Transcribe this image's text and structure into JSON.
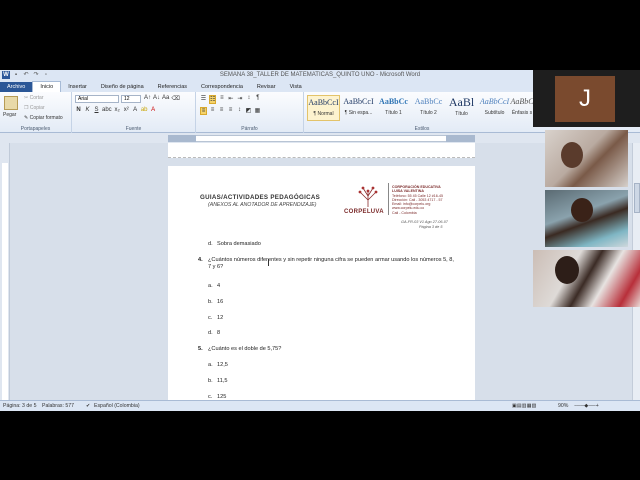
{
  "app": {
    "window_title": "SEMANA 38_TALLER DE MATEMATICAS_QUINTO UNO - Microsoft Word"
  },
  "ribbon": {
    "tabs": [
      "Archivo",
      "Inicio",
      "Insertar",
      "Diseño de página",
      "Referencias",
      "Correspondencia",
      "Revisar",
      "Vista"
    ],
    "active_tab": "Inicio",
    "clipboard": {
      "paste": "Pegar",
      "cut": "Cortar",
      "copy": "Copiar",
      "format_painter": "Copiar formato",
      "label": "Portapapeles"
    },
    "font": {
      "name": "Arial",
      "size": "12",
      "label": "Fuente"
    },
    "paragraph": {
      "label": "Párrafo"
    },
    "styles": {
      "label": "Estilos",
      "items": [
        {
          "sample": "AaBbCcI",
          "name": "¶ Normal"
        },
        {
          "sample": "AaBbCcI",
          "name": "¶ Sin espa..."
        },
        {
          "sample": "AaBbCc",
          "name": "Título 1"
        },
        {
          "sample": "AaBbCc",
          "name": "Título 2"
        },
        {
          "sample": "AaBl",
          "name": "Título"
        },
        {
          "sample": "AaBbCcI",
          "name": "Subtítulo"
        },
        {
          "sample": "AaBbC",
          "name": "Énfasis s"
        }
      ]
    }
  },
  "document": {
    "header_title": "GUIAS/ACTIVIDADES PEDAGÓGICAS",
    "header_subtitle": "(ANEXOS AL ANOTADOR DE APRENDIZAJE)",
    "logo_name": "CORPELUVA",
    "corp_info": [
      "CORPORACIÓN EDUCATIVA",
      "LUISA VALENTINA",
      "Teléfono: 55 45 Calle 12 #16-45",
      "Dirección: Cali - 3053 4717 - 57",
      "Email: info@corpelu.org",
      "www.corpelu.edu.co",
      "Cali - Colombia"
    ],
    "code_line": "GA-FR-03 V1 Ago 27-06-07",
    "page_label": "Página 3 de 5",
    "prev_option": {
      "letter": "d.",
      "text": "Sobra demasiado"
    },
    "q4": {
      "number": "4.",
      "text": "¿Cuántos números diferentes y sin repetir ninguna cifra se pueden armar usando los números 5, 8, 7 y 6?",
      "options": [
        {
          "letter": "a.",
          "text": "4"
        },
        {
          "letter": "b.",
          "text": "16"
        },
        {
          "letter": "c.",
          "text": "12"
        },
        {
          "letter": "d.",
          "text": "8"
        }
      ]
    },
    "q5": {
      "number": "5.",
      "text": "¿Cuánto es el doble de 5,75?",
      "options": [
        {
          "letter": "a.",
          "text": "12,5"
        },
        {
          "letter": "b.",
          "text": "11,5"
        },
        {
          "letter": "c.",
          "text": "125"
        }
      ]
    }
  },
  "statusbar": {
    "page": "Página: 3 de 5",
    "words": "Palabras: 577",
    "language": "Español (Colombia)",
    "zoom": "90%"
  },
  "video_call": {
    "avatar_initial": "J"
  }
}
